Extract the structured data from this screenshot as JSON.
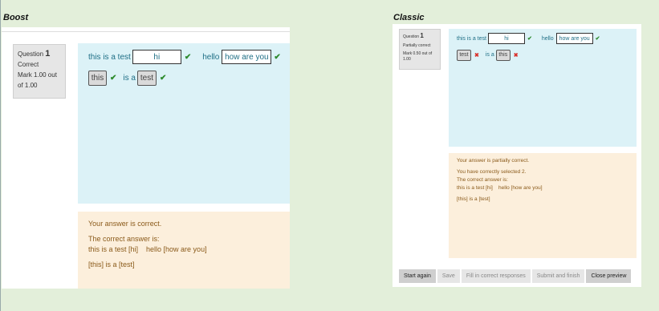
{
  "boost": {
    "heading": "Boost",
    "info": {
      "question_label": "Question",
      "question_number": "1",
      "state": "Correct",
      "mark": "Mark 1.00 out of 1.00"
    },
    "line1": {
      "before": "this is a test",
      "input1": "hi",
      "middle": "hello",
      "input2": "how are you"
    },
    "line2": {
      "drag1": "this",
      "middle": "is a",
      "drag2": "test"
    },
    "feedback": {
      "message": "Your answer is correct.",
      "correct_label": "The correct answer is:",
      "answer_line1": "this is a test [hi]    hello [how are you]",
      "answer_line2": "[this] is a [test]"
    }
  },
  "classic": {
    "heading": "Classic",
    "info": {
      "question_label": "Question",
      "question_number": "1",
      "state": "Partially correct",
      "mark": "Mark 0.50 out of 1.00"
    },
    "line1": {
      "before": "this is a test",
      "input1": "hi",
      "middle": "hello",
      "input2": "how are you"
    },
    "line2": {
      "drag1": "test",
      "middle": "is a",
      "drag2": "this"
    },
    "feedback": {
      "message": "Your answer is partially correct.",
      "selected": "You have correctly selected 2.",
      "correct_label": "The correct answer is:",
      "answer_line1": "this is a test [hi]    hello [how are you]",
      "answer_line2": "[this] is a [test]"
    }
  },
  "buttons": [
    "Start again",
    "Save",
    "Fill in correct responses",
    "Submit and finish",
    "Close preview"
  ],
  "icons": {
    "correct": "✔",
    "incorrect": "✖"
  },
  "colors": {
    "correct": "#2e8b2e",
    "incorrect": "#d9312b",
    "formulation_bg": "#dcf2f7",
    "feedback_bg": "#fcefdc"
  }
}
